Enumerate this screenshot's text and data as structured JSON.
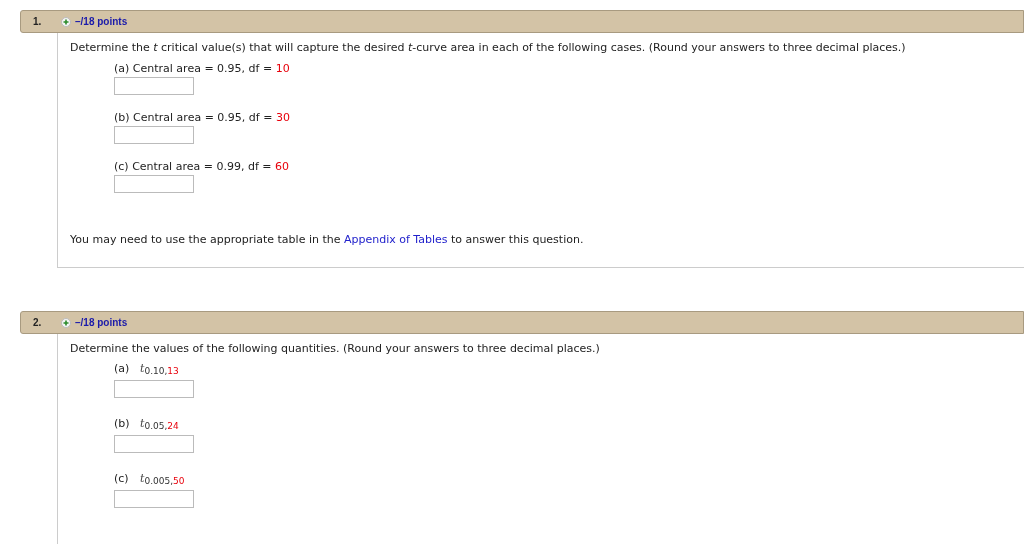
{
  "questions": [
    {
      "number": "1.",
      "points": "–/18 points",
      "prompt": "Determine the *t* critical value(s) that will capture the desired *t*-curve area in each of the following cases. (Round your answers to three decimal places.)",
      "parts": [
        {
          "kind": "text",
          "label": "(a) Central area = 0.95, df = ",
          "highlight": "10"
        },
        {
          "kind": "text",
          "label": "(b) Central area = 0.95, df = ",
          "highlight": "30"
        },
        {
          "kind": "text",
          "label": "(c) Central area = 0.99, df = ",
          "highlight": "60"
        }
      ],
      "note": {
        "before": "You may need to use the appropriate table in the ",
        "link": "Appendix of Tables",
        "after": " to answer this question."
      }
    },
    {
      "number": "2.",
      "points": "–/18 points",
      "prompt": "Determine the values of the following quantities. (Round your answers to three decimal places.)",
      "parts": [
        {
          "kind": "symbol",
          "label": "(a)",
          "symbol": "t",
          "subscript": "0.10,",
          "highlight": "13"
        },
        {
          "kind": "symbol",
          "label": "(b)",
          "symbol": "t",
          "subscript": "0.05,",
          "highlight": "24"
        },
        {
          "kind": "symbol",
          "label": "(c)",
          "symbol": "t",
          "subscript": "0.005,",
          "highlight": "50"
        }
      ]
    }
  ]
}
